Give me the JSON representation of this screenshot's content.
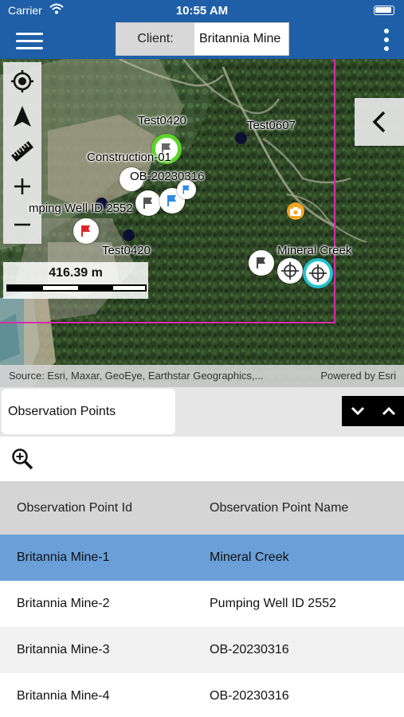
{
  "status_bar": {
    "carrier": "Carrier",
    "time": "10:55 AM"
  },
  "header": {
    "client_label": "Client:",
    "client_value": "Britannia Mine"
  },
  "map": {
    "scale_text": "416.39 m",
    "attribution_source": "Source: Esri, Maxar, GeoEye, Earthstar Geographics,...",
    "attribution_powered": "Powered by Esri",
    "labels": {
      "test0420_top": "Test0420",
      "test0607": "Test0607",
      "construction01": "Construction-01",
      "ob20230316": "OB-20230316",
      "pumping_well": "mping Well ID 2552",
      "test0420_bottom": "Test0420",
      "mineral_creek": "Mineral Creek"
    },
    "colors": {
      "boundary": "#d62ea8",
      "selected_ring": "#22c2cc",
      "green_ring": "#5dd32a",
      "flag_red": "#e0242b",
      "flag_blue": "#2d8be0"
    }
  },
  "layer": {
    "selected": "Observation Points"
  },
  "table": {
    "headers": [
      "Observation Point Id",
      "Observation Point Name"
    ],
    "rows": [
      {
        "id": "Britannia Mine-1",
        "name": "Mineral Creek",
        "selected": true
      },
      {
        "id": "Britannia Mine-2",
        "name": "Pumping Well ID 2552",
        "selected": false
      },
      {
        "id": "Britannia Mine-3",
        "name": "OB-20230316",
        "selected": false
      },
      {
        "id": "Britannia Mine-4",
        "name": "OB-20230316",
        "selected": false
      }
    ],
    "colors": {
      "selected_row": "#6a9fd8",
      "odd_row": "#f1f1f1",
      "even_row": "#ffffff"
    }
  }
}
